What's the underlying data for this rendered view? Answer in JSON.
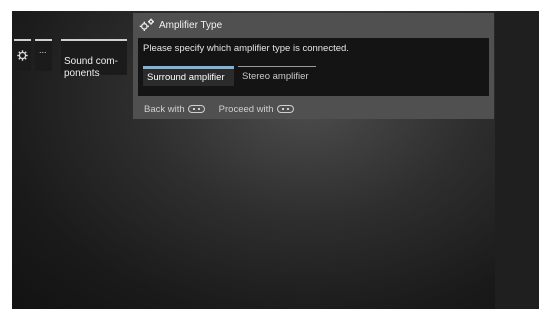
{
  "breadcrumb": {
    "items": [
      {
        "icon": "gear-icon"
      },
      {
        "label": "..."
      },
      {
        "label": "Sound com-\nponents"
      }
    ]
  },
  "dialog": {
    "icon": "gears-icon",
    "title": "Amplifier Type",
    "prompt": "Please specify which amplifier type is connected.",
    "options": [
      {
        "label": "Surround amplifier",
        "selected": true
      },
      {
        "label": "Stereo amplifier",
        "selected": false
      }
    ],
    "footer": {
      "back_label": "Back with",
      "back_key_icon": "rewind-key-icon",
      "proceed_label": "Proceed with",
      "proceed_key_icon": "forward-key-icon"
    }
  },
  "colors": {
    "selection_accent": "#7fb2d6",
    "dialog_background": "#505050",
    "panel_background": "#141414"
  }
}
